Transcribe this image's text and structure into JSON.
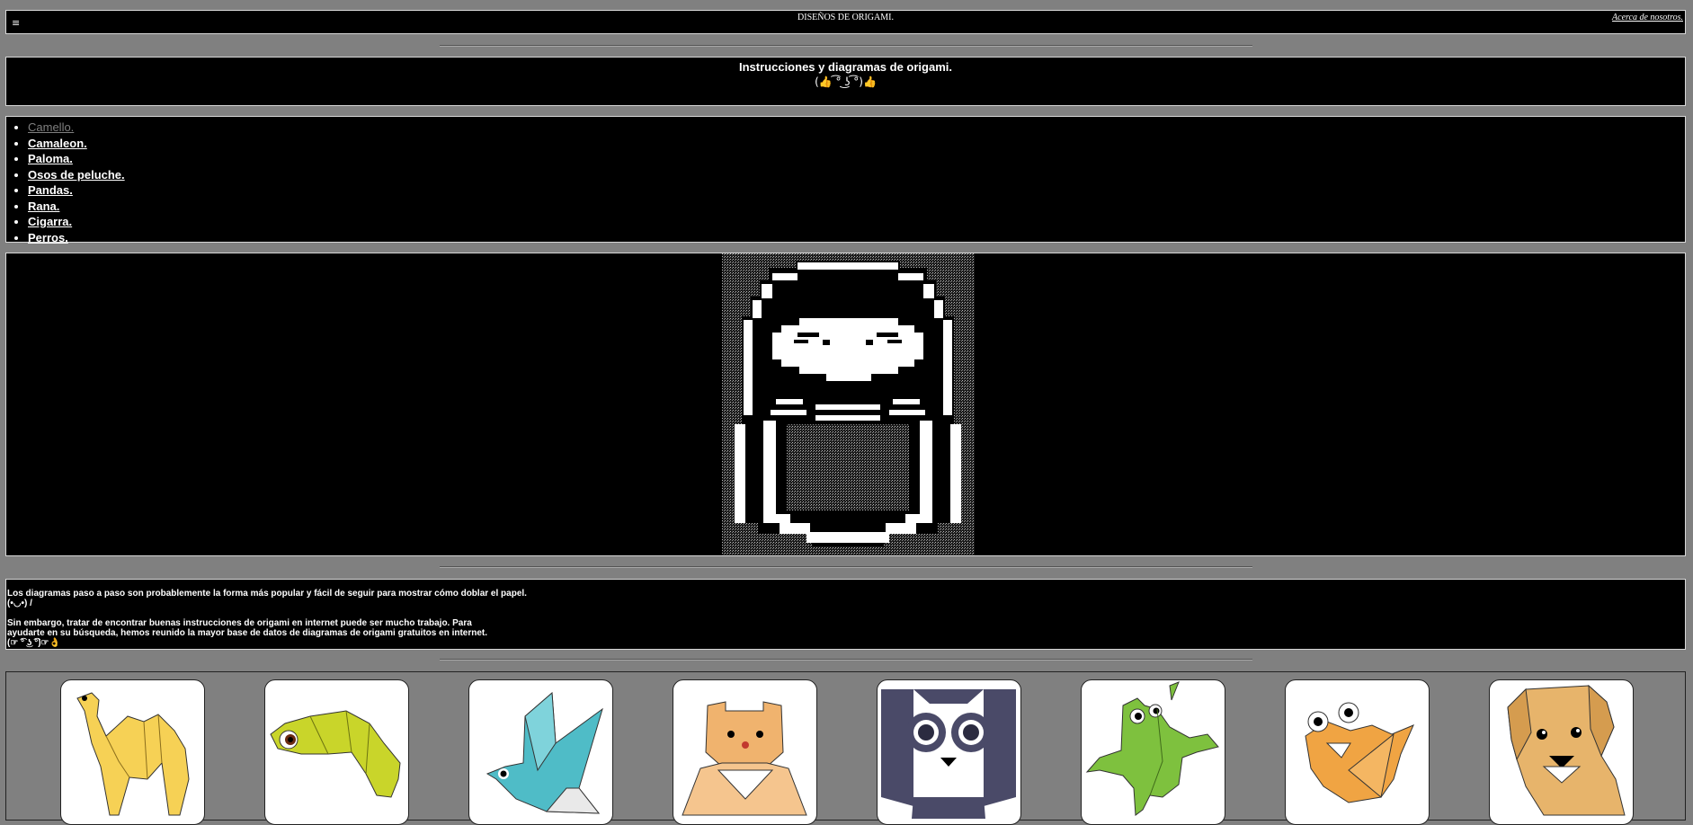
{
  "header": {
    "menu_icon": "≡",
    "title": "DISEÑOS DE ORIGAMI.",
    "about_link": "Acerca de nosotros."
  },
  "intro": {
    "title": "Instrucciones y diagramas de origami.",
    "face": "(👍 ͡° ͜ʖ ͡°)👍"
  },
  "nav": {
    "items": [
      {
        "label": "Camello."
      },
      {
        "label": "Camaleon."
      },
      {
        "label": "Paloma."
      },
      {
        "label": "Osos de peluche."
      },
      {
        "label": "Pandas."
      },
      {
        "label": "Rana."
      },
      {
        "label": "Cigarra."
      },
      {
        "label": "Perros."
      }
    ]
  },
  "description": {
    "p1": "Los diagramas paso a paso son probablemente la forma más popular y fácil de seguir para mostrar cómo doblar el papel.",
    "p1_face": "(•◡•) /",
    "p2": "Sin embargo, tratar de encontrar buenas instrucciones de origami en internet puede ser mucho trabajo. Para ayudarte en su búsqueda, hemos reunido la mayor base de datos de diagramas de origami gratuitos en internet.",
    "p2_face": "(☞ ͡° ͜ʖ ͡°)☞👌"
  },
  "gallery": {
    "cards": [
      {
        "icon": "camel-icon",
        "color": "#f6d155"
      },
      {
        "icon": "chameleon-icon",
        "color": "#c9d52a"
      },
      {
        "icon": "dove-icon",
        "color": "#4fbcc7"
      },
      {
        "icon": "teddy-bear-icon",
        "color": "#f0b36e"
      },
      {
        "icon": "panda-icon",
        "color": "#4a4a68"
      },
      {
        "icon": "frog-icon",
        "color": "#7ec13e"
      },
      {
        "icon": "cicada-icon",
        "color": "#f0a443"
      },
      {
        "icon": "dog-icon",
        "color": "#e7b46b"
      }
    ]
  },
  "colors": {
    "page_bg": "#808080",
    "panel_bg": "#000000",
    "text": "#ffffff"
  }
}
